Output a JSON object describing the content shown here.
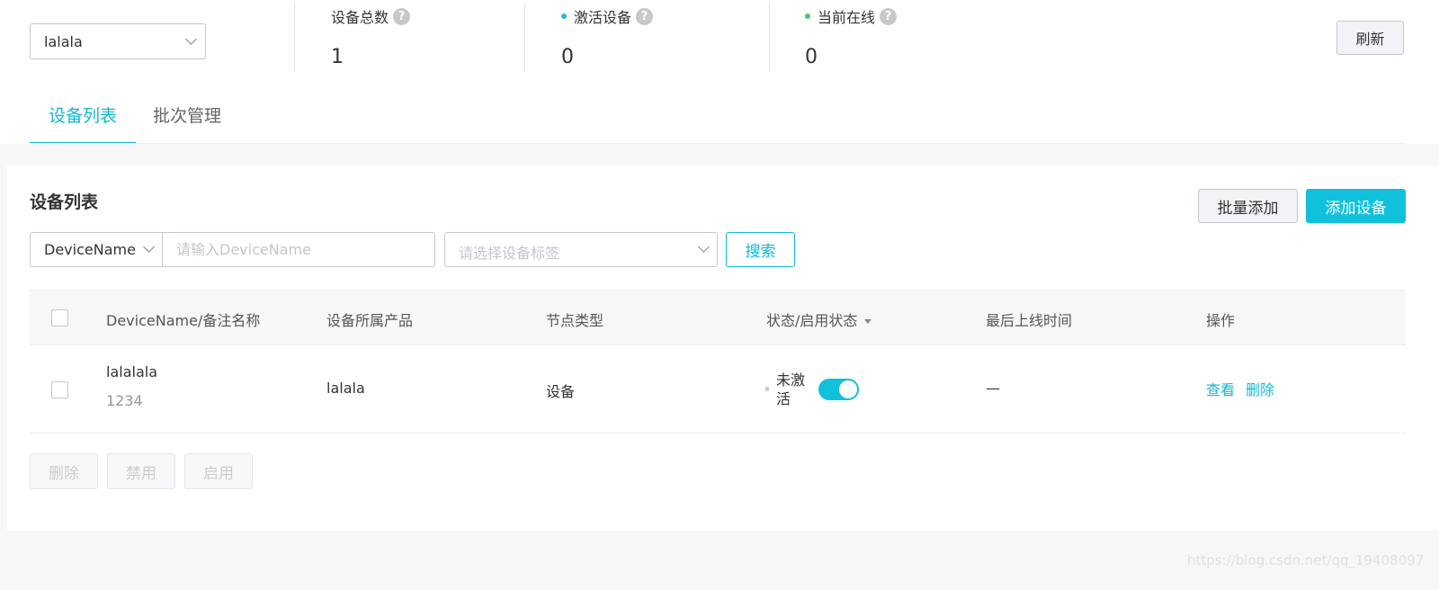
{
  "header": {
    "product_select": {
      "value": "lalala"
    },
    "stats": [
      {
        "label": "设备总数",
        "value": "1",
        "dot_color": ""
      },
      {
        "label": "激活设备",
        "value": "0",
        "dot_color": "#2ab4d9"
      },
      {
        "label": "当前在线",
        "value": "0",
        "dot_color": "#53c26b"
      }
    ],
    "help_glyph": "?",
    "refresh_label": "刷新"
  },
  "tabs": [
    {
      "label": "设备列表",
      "active": true
    },
    {
      "label": "批次管理",
      "active": false
    }
  ],
  "card": {
    "title": "设备列表",
    "batch_add_label": "批量添加",
    "add_device_label": "添加设备",
    "filter": {
      "field_value": "DeviceName",
      "input_placeholder": "请输入DeviceName",
      "tag_placeholder": "请选择设备标签",
      "search_label": "搜索"
    },
    "table": {
      "columns": [
        "DeviceName/备注名称",
        "设备所属产品",
        "节点类型",
        "状态/启用状态",
        "最后上线时间",
        "操作"
      ],
      "rows": [
        {
          "device_name": "lalalala",
          "remark": "1234",
          "product": "lalala",
          "node_type": "设备",
          "status": "未激活",
          "enabled": true,
          "last_online": "—",
          "actions": [
            "查看",
            "删除"
          ]
        }
      ]
    },
    "bulk_actions": [
      "删除",
      "禁用",
      "启用"
    ]
  },
  "watermark": "https://blog.csdn.net/qq_19408097",
  "colors": {
    "accent": "#11c1dc",
    "link": "#11b8d3",
    "active_dot": "#2ab4d9",
    "online_dot": "#53c26b"
  },
  "icons": [
    "chevron-down-icon",
    "help-icon",
    "sort-icon",
    "status-dot-icon"
  ]
}
